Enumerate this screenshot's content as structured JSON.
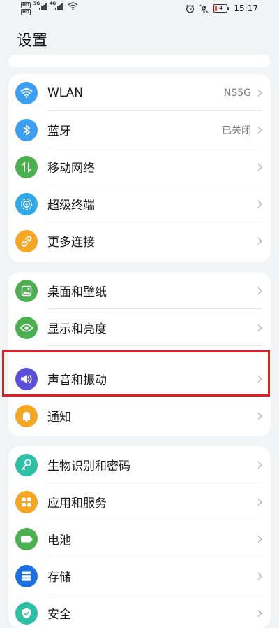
{
  "status_bar": {
    "network_gen_1": "5G",
    "network_gen_2": "4G",
    "hd_label": "HD",
    "battery_level": "4",
    "time": "15:17",
    "icons": [
      "hd-icon",
      "signal-icon",
      "wifi-icon",
      "alarm-icon",
      "mute-icon",
      "battery-icon"
    ]
  },
  "header": {
    "title": "设置"
  },
  "groups": {
    "network": [
      {
        "label": "WLAN",
        "value": "NS5G",
        "icon": "wifi-icon",
        "color": "#3d9ff0"
      },
      {
        "label": "蓝牙",
        "value": "已关闭",
        "icon": "bluetooth-icon",
        "color": "#3d9ff0"
      },
      {
        "label": "移动网络",
        "value": "",
        "icon": "mobile-data-icon",
        "color": "#4caf50"
      },
      {
        "label": "超级终端",
        "value": "",
        "icon": "super-device-icon",
        "color": "#2fa9e8"
      },
      {
        "label": "更多连接",
        "value": "",
        "icon": "link-icon",
        "color": "#f5a623"
      }
    ],
    "display": [
      {
        "label": "桌面和壁纸",
        "icon": "wallpaper-icon",
        "color": "#4caf50"
      },
      {
        "label": "显示和亮度",
        "icon": "eye-icon",
        "color": "#4caf50"
      },
      {
        "label": "声音和振动",
        "icon": "volume-icon",
        "color": "#5b4ed8"
      },
      {
        "label": "通知",
        "icon": "bell-icon",
        "color": "#f5a623"
      }
    ],
    "system": [
      {
        "label": "生物识别和密码",
        "icon": "key-icon",
        "color": "#2ebfa5"
      },
      {
        "label": "应用和服务",
        "icon": "apps-icon",
        "color": "#f5a623"
      },
      {
        "label": "电池",
        "icon": "battery-icon",
        "color": "#4caf50"
      },
      {
        "label": "存储",
        "icon": "storage-icon",
        "color": "#1e6fe0"
      },
      {
        "label": "安全",
        "icon": "shield-icon",
        "color": "#2ebfa5"
      }
    ]
  },
  "highlight_color": "#e02020"
}
